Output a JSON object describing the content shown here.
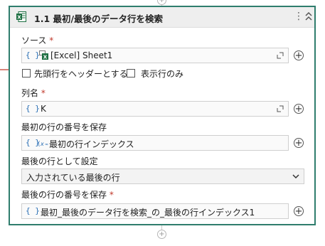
{
  "header": {
    "title": "1.1 最初/最後のデータ行を検索",
    "icon": "excel-icon",
    "kebab": "⋮"
  },
  "source": {
    "label": "ソース",
    "required_mark": "*",
    "value": "[Excel] Sheet1"
  },
  "options": {
    "first_row_header_label": "先頭行をヘッダーとする",
    "first_row_header_checked": false,
    "visible_rows_only_label": "表示行のみ",
    "visible_rows_only_checked": false
  },
  "column_name": {
    "label": "列名",
    "required_mark": "*",
    "value": "K"
  },
  "save_first_row": {
    "label": "最初の行の番号を保存",
    "value": "最初の行インデックス"
  },
  "set_as_last_row": {
    "label": "最後の行として設定",
    "selected": "入力されている最後の行"
  },
  "save_last_row": {
    "label": "最後の行の番号を保存",
    "required_mark": "*",
    "value": "最初_最後のデータ行を検索_の_最後の行インデックス1"
  },
  "glyphs": {
    "braces": "{ }",
    "plus": "+"
  },
  "colors": {
    "border_accent": "#2f7d6d",
    "header_bg": "#eeeeee",
    "required": "#c0392b",
    "arrow": "#c0392b",
    "braces": "#2a6fb5"
  }
}
